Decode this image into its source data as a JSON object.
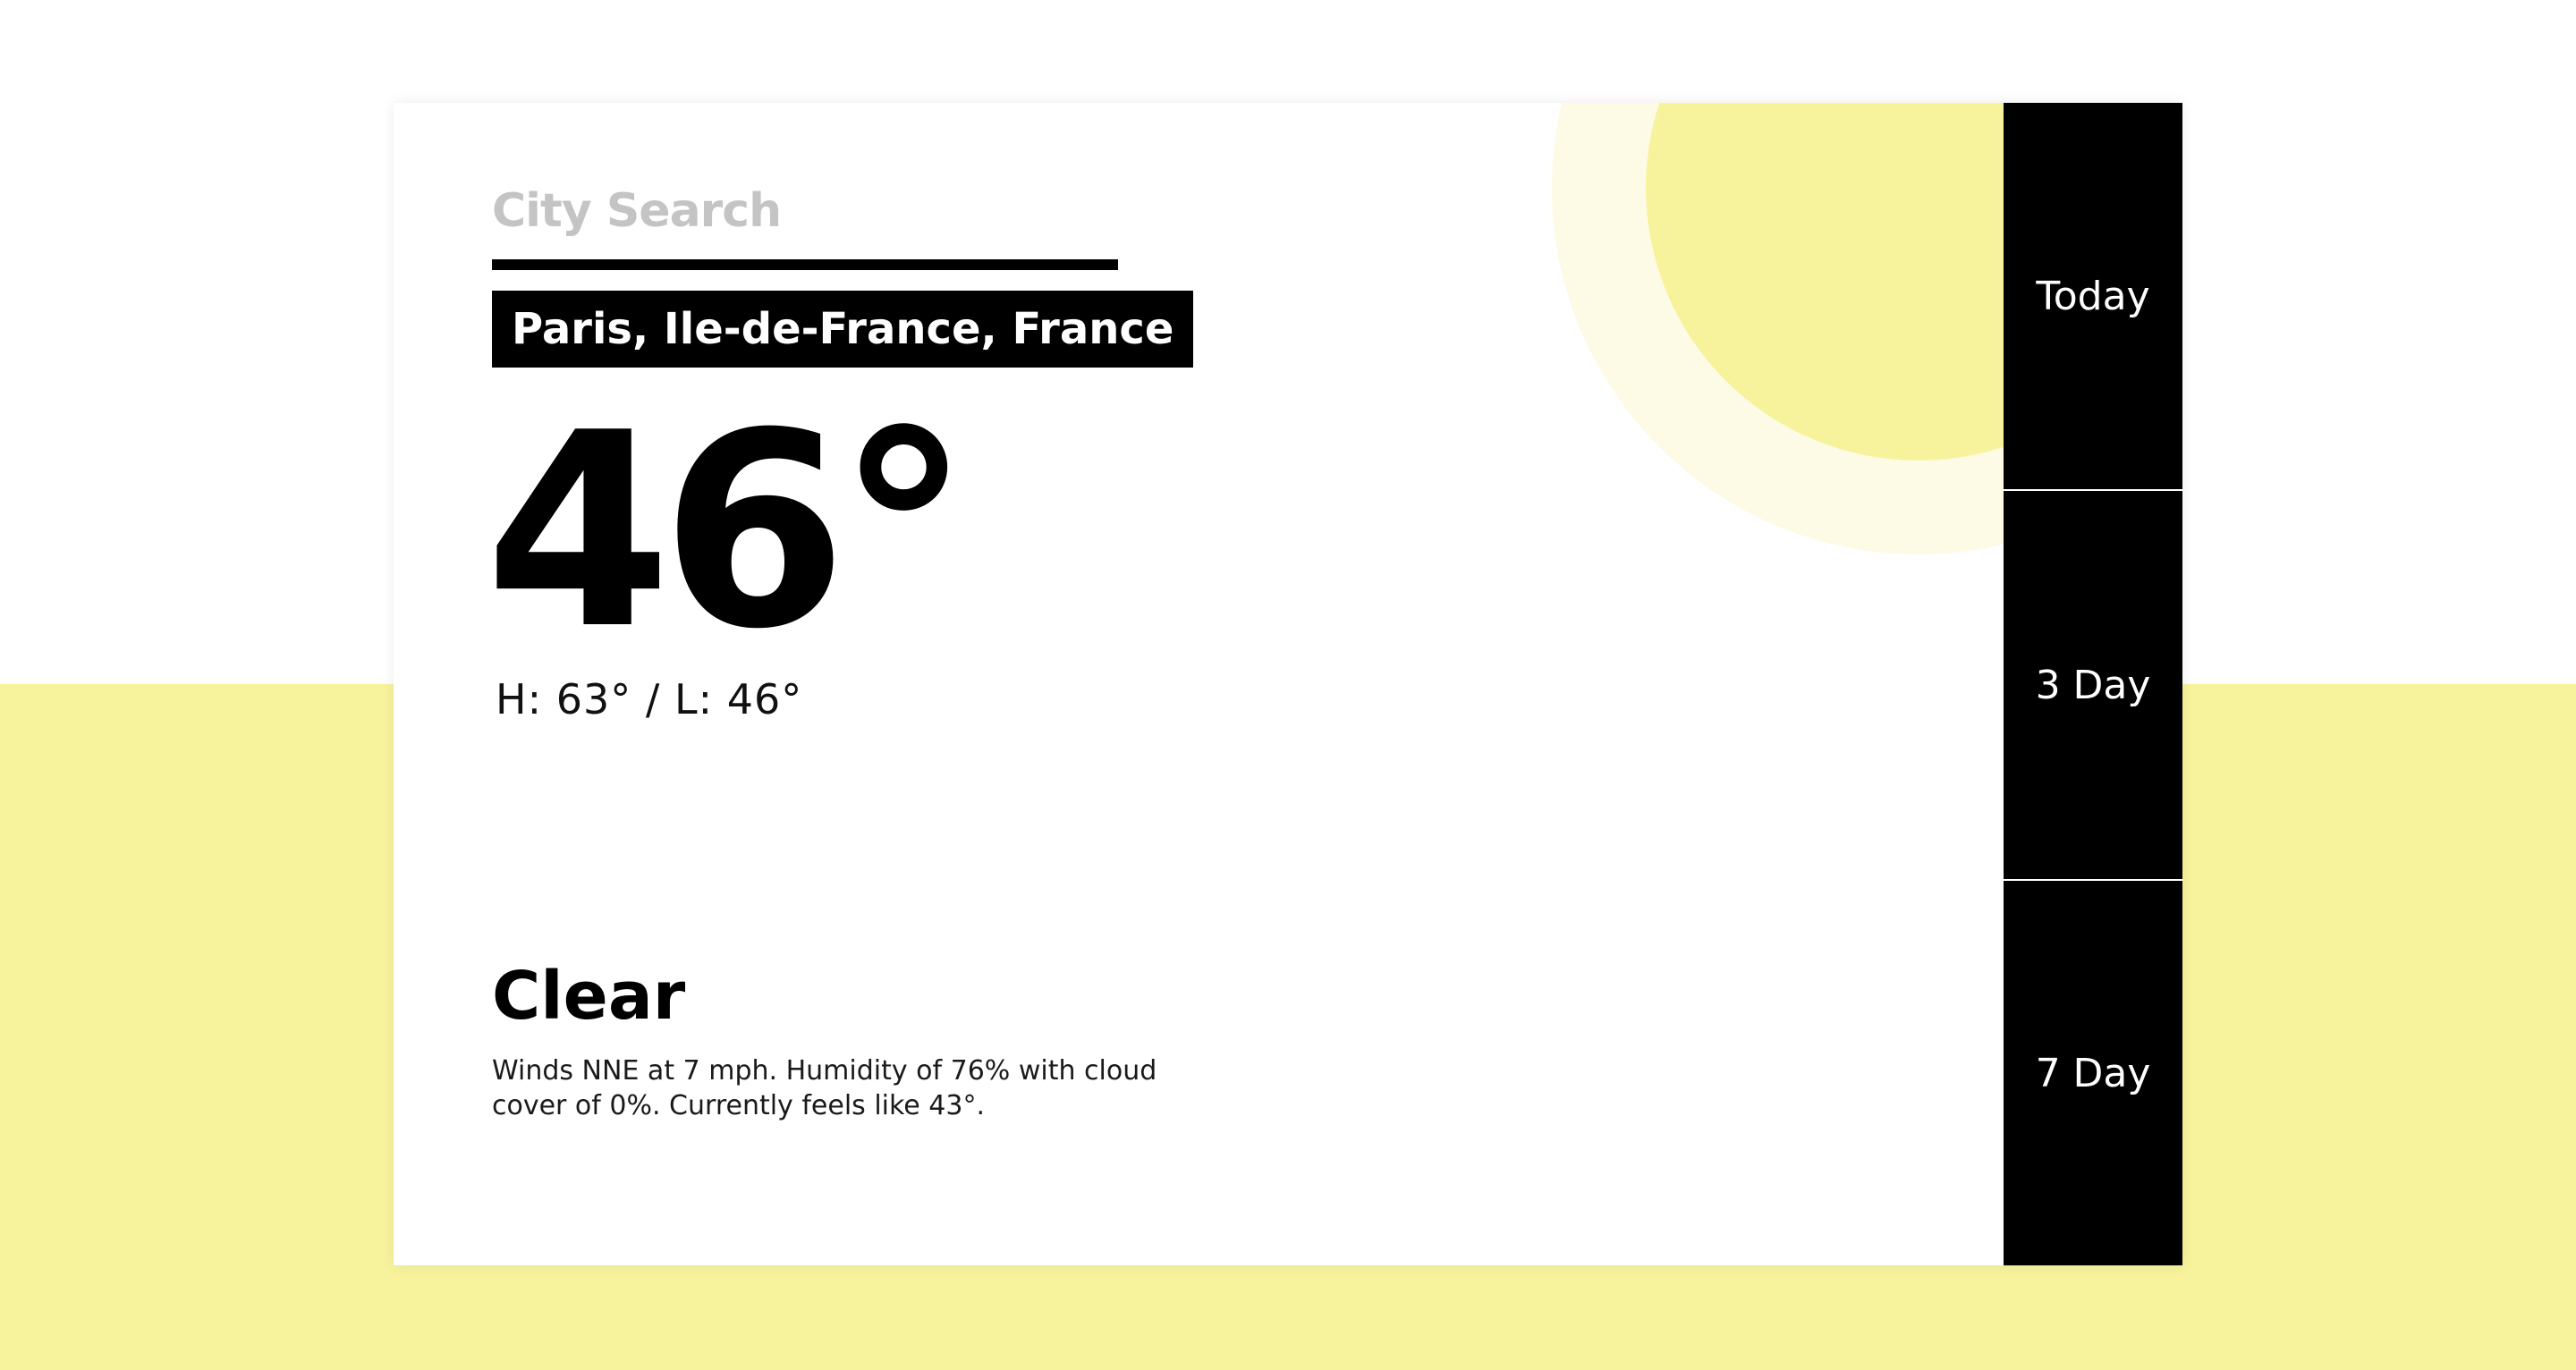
{
  "search": {
    "label": "City Search",
    "value": "",
    "placeholder": ""
  },
  "location": {
    "name": "Paris, Ile-de-France, France"
  },
  "current": {
    "temperature": "46°",
    "high_low": "H: 63° / L: 46°",
    "condition": "Clear",
    "description": "Winds NNE at 7 mph. Humidity of 76% with cloud cover of 0%. Currently feels like 43°."
  },
  "tabs": [
    {
      "label": "Today"
    },
    {
      "label": "3 Day"
    },
    {
      "label": "7 Day"
    }
  ],
  "colors": {
    "accent_yellow": "#f7f39c",
    "sun_halo": "#fdfbe6",
    "tab_background": "#000000",
    "search_label": "#c4c4c4"
  },
  "icons": {
    "sun": "sun-graphic"
  }
}
